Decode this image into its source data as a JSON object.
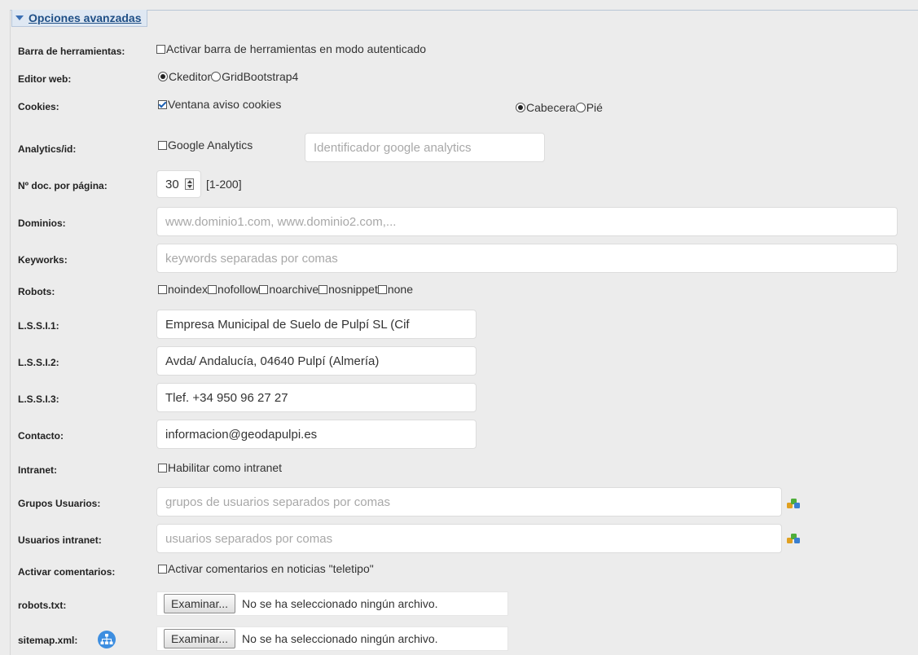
{
  "section": {
    "title": "Opciones avanzadas"
  },
  "toolbar": {
    "label": "Barra de herramientas:",
    "option": "Activar barra de herramientas en modo autenticado"
  },
  "editor": {
    "label": "Editor web:",
    "options": [
      "Ckeditor",
      "GridBootstrap4"
    ],
    "selected": "Ckeditor"
  },
  "cookies": {
    "label": "Cookies:",
    "checkbox": "Ventana aviso cookies",
    "position_options": [
      "Cabecera",
      "Pié"
    ],
    "position_selected": "Cabecera"
  },
  "analytics": {
    "label": "Analytics/id:",
    "checkbox": "Google Analytics",
    "placeholder": "Identificador google analytics"
  },
  "pagination": {
    "label": "Nº doc. por página:",
    "value": "30",
    "range": "[1-200]"
  },
  "dominios": {
    "label": "Dominios:",
    "placeholder": "www.dominio1.com, www.dominio2.com,..."
  },
  "keywords": {
    "label": "Keyworks:",
    "placeholder": "keywords separadas por comas"
  },
  "robots": {
    "label": "Robots:",
    "options": [
      "noindex",
      "nofollow",
      "noarchive",
      "nosnippet",
      "none"
    ]
  },
  "lssi1": {
    "label": "L.S.S.I.1:",
    "value": "Empresa Municipal de Suelo de Pulpí SL (Cif"
  },
  "lssi2": {
    "label": "L.S.S.I.2:",
    "value": "Avda/ Andalucía, 04640 Pulpí (Almería)"
  },
  "lssi3": {
    "label": "L.S.S.I.3:",
    "value": "Tlef. +34 950 96 27 27"
  },
  "contacto": {
    "label": "Contacto:",
    "value": "informacion@geodapulpi.es"
  },
  "intranet": {
    "label": "Intranet:",
    "checkbox": "Habilitar como intranet"
  },
  "grupos": {
    "label": "Grupos Usuarios:",
    "placeholder": "grupos de usuarios separados por comas"
  },
  "usuarios": {
    "label": "Usuarios intranet:",
    "placeholder": "usuarios separados por comas"
  },
  "comentarios": {
    "label": "Activar comentarios:",
    "checkbox": "Activar comentarios en noticias \"teletipo\""
  },
  "robots_txt": {
    "label": "robots.txt:",
    "button": "Examinar...",
    "status": "No se ha seleccionado ningún archivo."
  },
  "sitemap": {
    "label": "sitemap.xml:",
    "button": "Examinar...",
    "status": "No se ha seleccionado ningún archivo."
  },
  "colors": {
    "accent": "#3b6fb4",
    "legend_bg": "#dfe8f3",
    "page_bg": "#ececec"
  },
  "icons": {
    "group": "users-group-icon",
    "sitemap": "sitemap-icon"
  }
}
